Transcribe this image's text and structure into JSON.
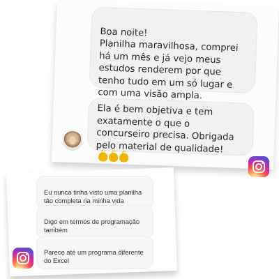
{
  "top_card": {
    "message_1": "Boa noite!\nPlanilha maravilhosa, comprei há um mês e já vejo meus estudos renderem por que tenho tudo em um só lugar e com uma visão ampla.",
    "message_2": "Ela é bem objetiva e tem exatamente o que o concurseiro precisa. Obrigada pelo material de qualidade!",
    "emoji": "clapping-hands x3",
    "avatar": "profile-photo"
  },
  "bottom_card": {
    "messages": [
      "Eu nunca tinha visto uma planilha tão completa na minha vida",
      "Digo em termos de programação também",
      "Parece até um programa diferente do Excel"
    ]
  },
  "badges": {
    "icon": "instagram-icon"
  }
}
